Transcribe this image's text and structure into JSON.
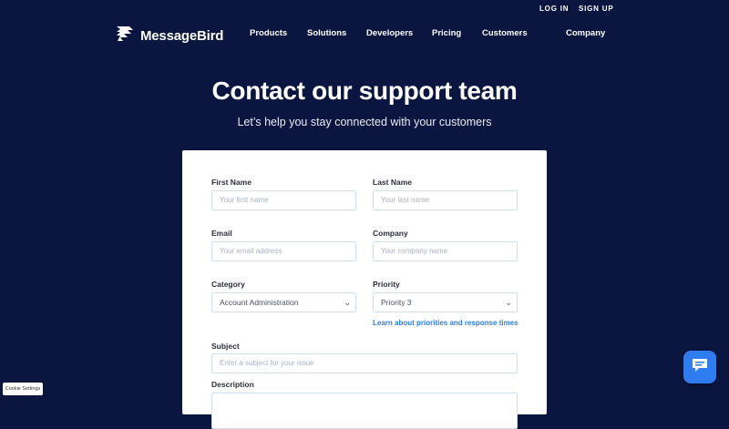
{
  "topnav": {
    "login": "LOG IN",
    "signup": "SIGN UP"
  },
  "brand": {
    "name": "MessageBird"
  },
  "nav": {
    "items": [
      "Products",
      "Solutions",
      "Developers",
      "Pricing",
      "Customers",
      "Company"
    ]
  },
  "hero": {
    "title": "Contact our support team",
    "subtitle": "Let’s help you stay connected with your customers"
  },
  "form": {
    "first_name": {
      "label": "First Name",
      "placeholder": "Your first name"
    },
    "last_name": {
      "label": "Last Name",
      "placeholder": "Your last name"
    },
    "email": {
      "label": "Email",
      "placeholder": "Your email address"
    },
    "company": {
      "label": "Company",
      "placeholder": "Your company name"
    },
    "category": {
      "label": "Category",
      "value": "Account Administration"
    },
    "priority": {
      "label": "Priority",
      "value": "Priority 3",
      "help_link": "Learn about priorities and response times"
    },
    "subject": {
      "label": "Subject",
      "placeholder": "Enter a subject for your issue"
    },
    "description": {
      "label": "Description"
    }
  },
  "cookie": {
    "label": "Cookie Settings"
  },
  "colors": {
    "background": "#0b1640",
    "accent": "#2e7cf0",
    "link": "#2f7fe0"
  }
}
